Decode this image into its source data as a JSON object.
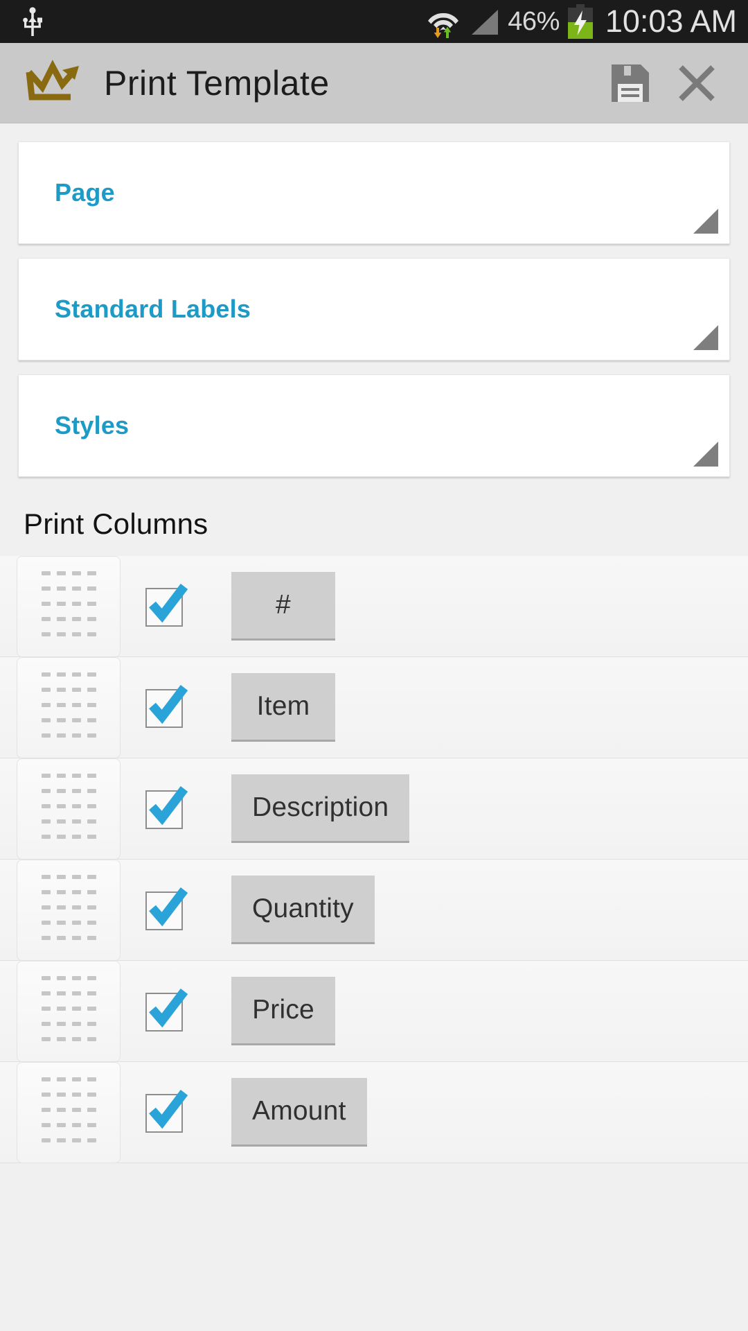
{
  "status_bar": {
    "usb_icon": "usb-icon",
    "wifi_icon": "wifi-icon",
    "signal_icon": "cell-signal-icon",
    "battery_icon": "battery-charging-icon",
    "battery_percent": "46%",
    "time": "10:03 AM"
  },
  "action_bar": {
    "logo_icon": "crown-arrow-logo-icon",
    "title": "Print Template",
    "save_icon": "save-floppy-icon",
    "close_icon": "close-x-icon"
  },
  "sections": [
    {
      "label": "Page",
      "expander_icon": "resize-corner-icon"
    },
    {
      "label": "Standard Labels",
      "expander_icon": "resize-corner-icon"
    },
    {
      "label": "Styles",
      "expander_icon": "resize-corner-icon"
    }
  ],
  "print_columns": {
    "title": "Print Columns",
    "rows": [
      {
        "label": "#",
        "checked": true,
        "drag_icon": "drag-handle-icon",
        "check_icon": "checkbox-checked-icon"
      },
      {
        "label": "Item",
        "checked": true,
        "drag_icon": "drag-handle-icon",
        "check_icon": "checkbox-checked-icon"
      },
      {
        "label": "Description",
        "checked": true,
        "drag_icon": "drag-handle-icon",
        "check_icon": "checkbox-checked-icon"
      },
      {
        "label": "Quantity",
        "checked": true,
        "drag_icon": "drag-handle-icon",
        "check_icon": "checkbox-checked-icon"
      },
      {
        "label": "Price",
        "checked": true,
        "drag_icon": "drag-handle-icon",
        "check_icon": "checkbox-checked-icon"
      },
      {
        "label": "Amount",
        "checked": true,
        "drag_icon": "drag-handle-icon",
        "check_icon": "checkbox-checked-icon"
      }
    ]
  },
  "colors": {
    "accent_cyan": "#1e9ac7",
    "logo_gold": "#8a6a10",
    "status_bar_bg": "#1b1b1b",
    "action_bar_bg": "#c9c9c9",
    "page_bg": "#f0f0f0",
    "chip_bg": "#cfcfcf",
    "battery_green": "#7cb518"
  }
}
